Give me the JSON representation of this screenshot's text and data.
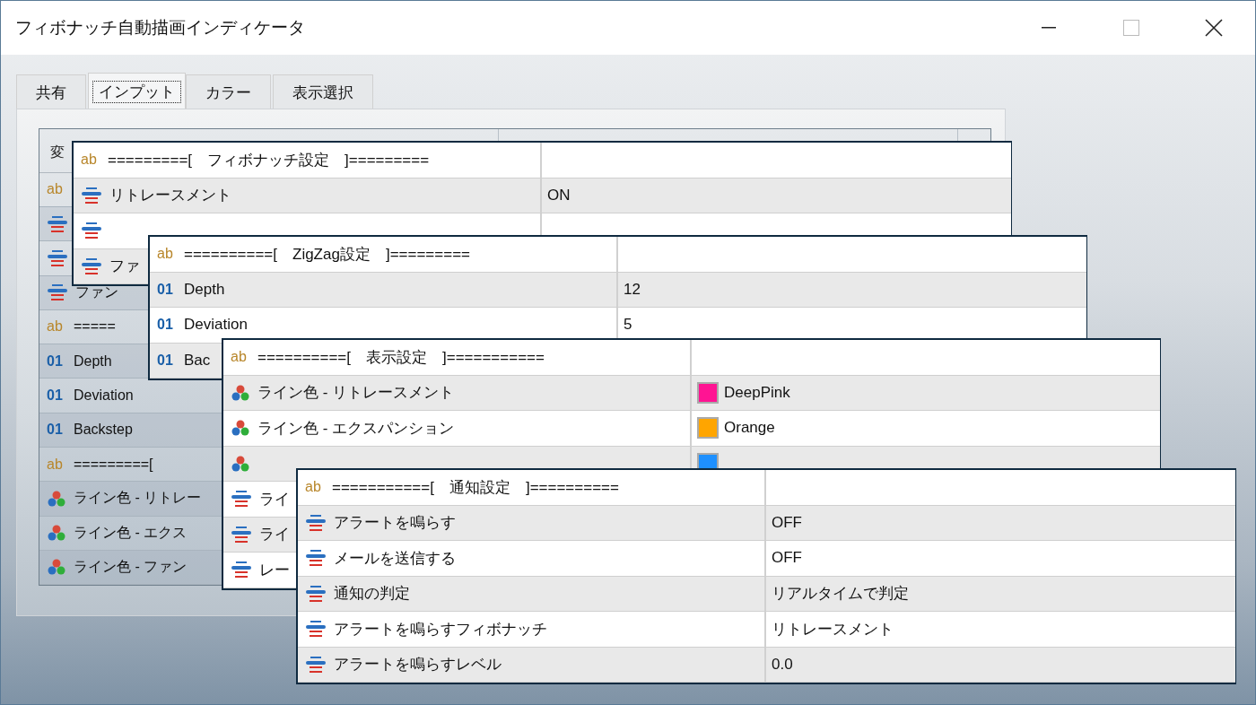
{
  "window": {
    "title": "フィボナッチ自動描画インディケータ"
  },
  "tabs": [
    {
      "label": "共有",
      "selected": false
    },
    {
      "label": "インプット",
      "selected": true
    },
    {
      "label": "カラー",
      "selected": false
    },
    {
      "label": "表示選択",
      "selected": false
    }
  ],
  "background_table": {
    "header": "変",
    "rows": [
      {
        "kind": "string",
        "badge": "ab"
      },
      {
        "kind": "enum"
      },
      {
        "kind": "enum"
      },
      {
        "kind": "enum",
        "label": "ファン"
      },
      {
        "kind": "string",
        "badge": "ab",
        "label": "====="
      },
      {
        "kind": "int",
        "badge": "01",
        "label": "Depth"
      },
      {
        "kind": "int",
        "badge": "01",
        "label": "Deviation"
      },
      {
        "kind": "int",
        "badge": "01",
        "label": "Backstep"
      },
      {
        "kind": "string",
        "badge": "ab",
        "label": "=========["
      },
      {
        "kind": "color",
        "label": "ライン色 - リトレー"
      },
      {
        "kind": "color",
        "label": "ライン色 - エクス"
      },
      {
        "kind": "color",
        "label": "ライン色 - ファン"
      }
    ]
  },
  "panels": [
    {
      "rows": [
        {
          "kind": "string",
          "badge": "ab",
          "label": "=========[　フィボナッチ設定　]========="
        },
        {
          "kind": "enum",
          "label": "リトレースメント",
          "value": "ON"
        },
        {
          "kind": "enum"
        },
        {
          "kind": "enum",
          "label": "ファ"
        }
      ]
    },
    {
      "rows": [
        {
          "kind": "string",
          "badge": "ab",
          "label": "==========[　ZigZag設定　]========="
        },
        {
          "kind": "int",
          "badge": "01",
          "label": "Depth",
          "value": "12"
        },
        {
          "kind": "int",
          "badge": "01",
          "label": "Deviation",
          "value": "5"
        },
        {
          "kind": "int",
          "badge": "01",
          "label": "Bac"
        }
      ]
    },
    {
      "rows": [
        {
          "kind": "string",
          "badge": "ab",
          "label": "==========[　表示設定　]==========="
        },
        {
          "kind": "color",
          "label": "ライン色 - リトレースメント",
          "value": "DeepPink",
          "color": "#ff1493"
        },
        {
          "kind": "color",
          "label": "ライン色 - エクスパンション",
          "value": "Orange",
          "color": "#ffa500"
        },
        {
          "kind": "color",
          "color": "#1e90ff"
        },
        {
          "kind": "enum",
          "label": "ライ"
        },
        {
          "kind": "enum",
          "label": "ライ"
        },
        {
          "kind": "enum",
          "label": "レー"
        }
      ]
    },
    {
      "rows": [
        {
          "kind": "string",
          "badge": "ab",
          "label": "===========[　通知設定　]=========="
        },
        {
          "kind": "enum",
          "label": "アラートを鳴らす",
          "value": "OFF"
        },
        {
          "kind": "enum",
          "label": "メールを送信する",
          "value": "OFF"
        },
        {
          "kind": "enum",
          "label": "通知の判定",
          "value": "リアルタイムで判定"
        },
        {
          "kind": "enum",
          "label": "アラートを鳴らすフィボナッチ",
          "value": "リトレースメント"
        },
        {
          "kind": "enum",
          "label": "アラートを鳴らすレベル",
          "value": "0.0"
        }
      ]
    }
  ]
}
